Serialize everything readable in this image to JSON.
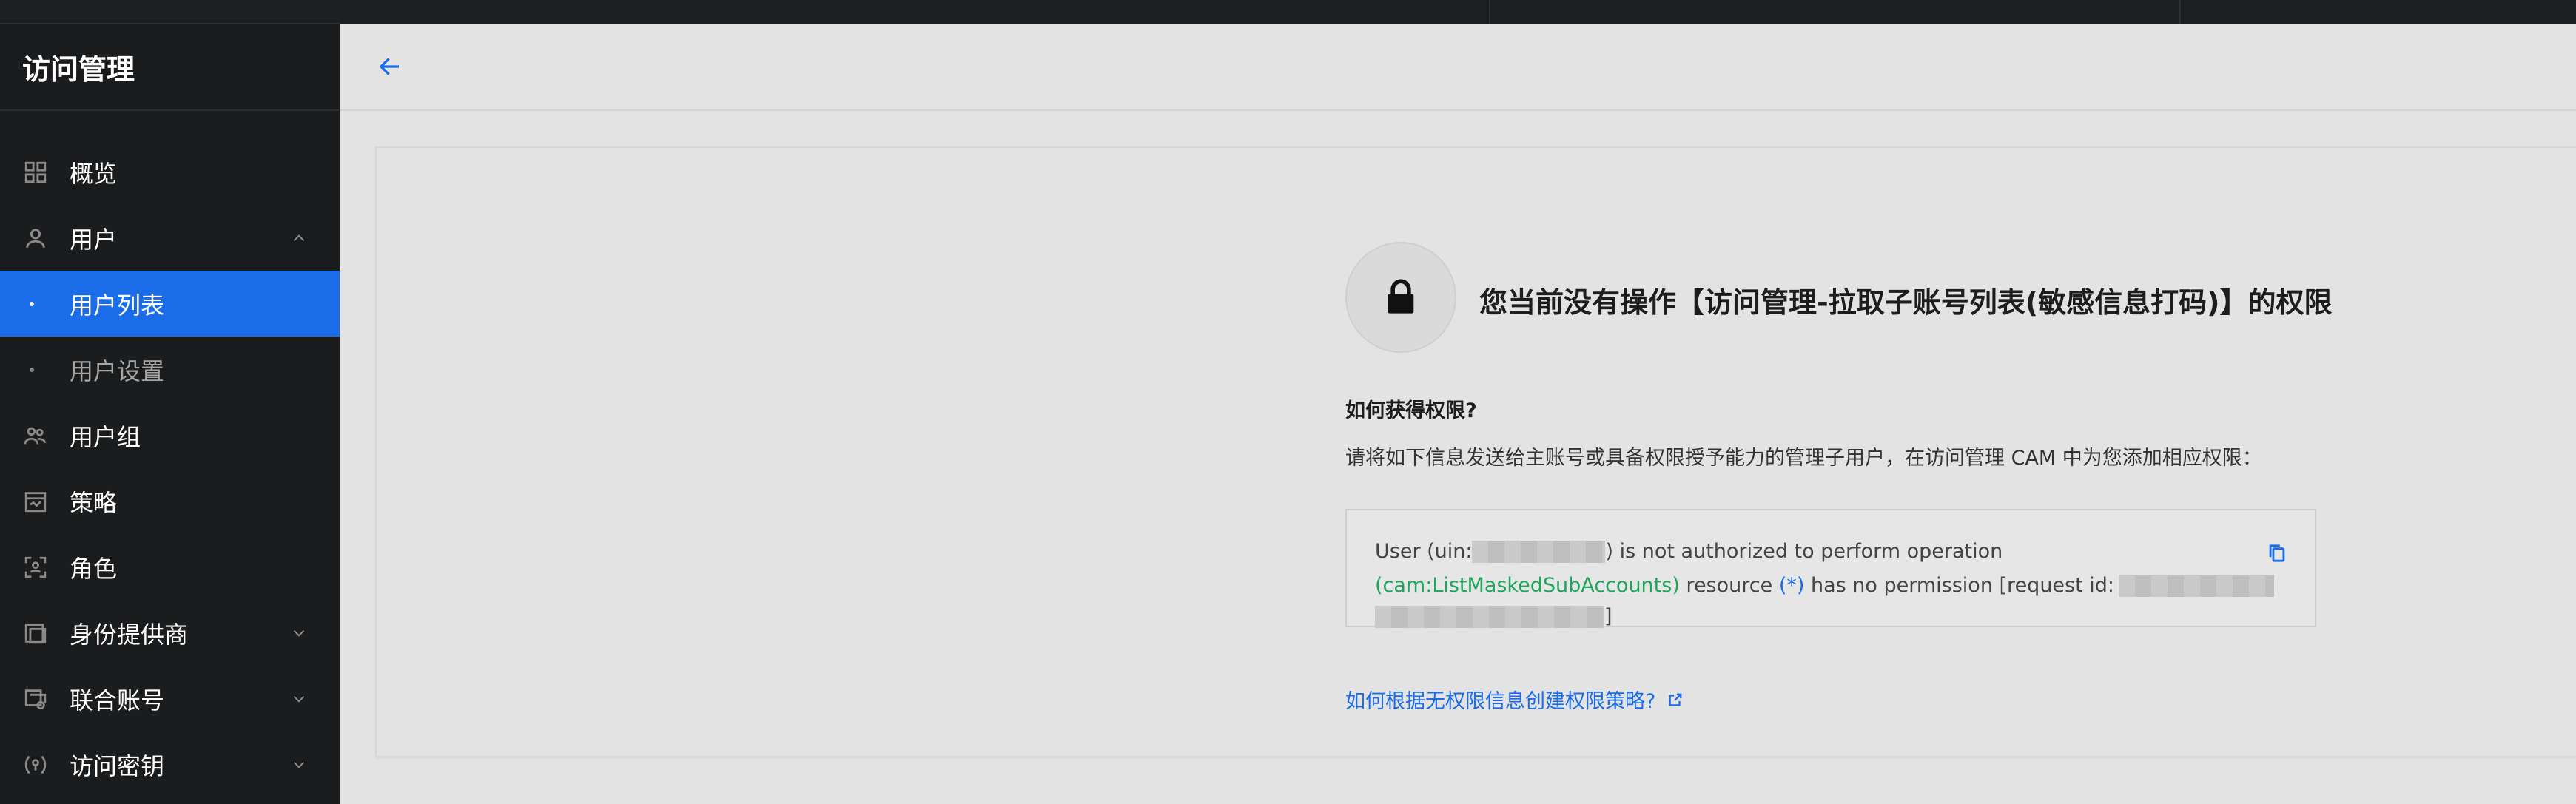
{
  "sidebar": {
    "title": "访问管理",
    "items": [
      {
        "label": "概览",
        "icon": "dashboard-icon"
      },
      {
        "label": "用户",
        "icon": "user-icon",
        "expanded": true
      },
      {
        "label": "用户列表",
        "sub": true,
        "active": true
      },
      {
        "label": "用户设置",
        "sub": true
      },
      {
        "label": "用户组",
        "icon": "user-group-icon"
      },
      {
        "label": "策略",
        "icon": "policy-icon"
      },
      {
        "label": "角色",
        "icon": "role-icon"
      },
      {
        "label": "身份提供商",
        "icon": "identity-provider-icon"
      },
      {
        "label": "联合账号",
        "icon": "federated-account-icon"
      },
      {
        "label": "访问密钥",
        "icon": "access-key-icon"
      }
    ]
  },
  "header": {
    "back_icon": "back-arrow-icon"
  },
  "permission": {
    "title": "您当前没有操作【访问管理-拉取子账号列表(敏感信息打码)】的权限",
    "how_title": "如何获得权限?",
    "how_desc": "请将如下信息发送给主账号或具备权限授予能力的管理子用户，在访问管理 CAM 中为您添加相应权限：",
    "error": {
      "line1_prefix": "User (uin: ",
      "line1_suffix": ") is not authorized to perform operation",
      "operation": "(cam:ListMaskedSubAccounts)",
      "resource_text": " resource ",
      "resource": "(*)",
      "no_perm": " has no permission [request id:",
      "close_bracket": "]"
    },
    "help_link": "如何根据无权限信息创建权限策略?"
  },
  "colors": {
    "accent": "#1a6ce8",
    "sidebar_bg": "#1b1c1e",
    "operation_green": "#1fa65a"
  }
}
